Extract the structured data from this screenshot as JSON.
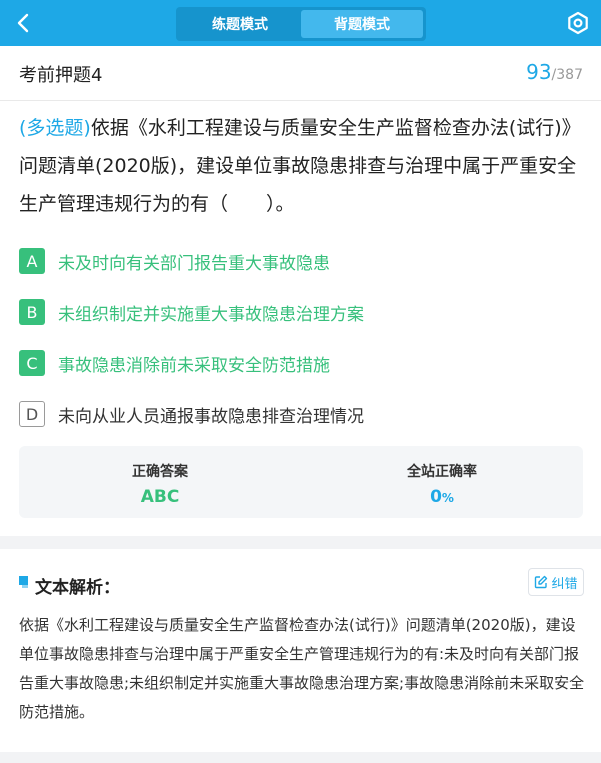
{
  "colors": {
    "primary": "#1ea8e6",
    "correct": "#37c07c"
  },
  "header": {
    "back_icon": "chevron-left-icon",
    "tabs": [
      {
        "label": "练题模式",
        "active": false
      },
      {
        "label": "背题模式",
        "active": true
      }
    ],
    "settings_icon": "settings-icon"
  },
  "question_header": {
    "title": "考前押题4",
    "current": "93",
    "separator": "/",
    "total": "387"
  },
  "question": {
    "type_label": "(多选题)",
    "text": "依据《水利工程建设与质量安全生产监督检查办法(试行)》问题清单(2020版)，建设单位事故隐患排查与治理中属于严重安全生产管理违规行为的有（　　）。"
  },
  "options": [
    {
      "letter": "A",
      "text": "未及时向有关部门报告重大事故隐患",
      "correct": true
    },
    {
      "letter": "B",
      "text": "未组织制定并实施重大事故隐患治理方案",
      "correct": true
    },
    {
      "letter": "C",
      "text": "事故隐患消除前未采取安全防范措施",
      "correct": true
    },
    {
      "letter": "D",
      "text": "未向从业人员通报事故隐患排查治理情况",
      "correct": false
    }
  ],
  "stats": {
    "answer_label": "正确答案",
    "answer_value": "ABC",
    "rate_label": "全站正确率",
    "rate_value": "0",
    "rate_unit": "%"
  },
  "analysis": {
    "title": "文本解析：",
    "report_label": "纠错",
    "report_icon": "edit-icon",
    "text": "依据《水利工程建设与质量安全生产监督检查办法(试行)》问题清单(2020版)，建设单位事故隐患排查与治理中属于严重安全生产管理违规行为的有:未及时向有关部门报告重大事故隐患;未组织制定并实施重大事故隐患治理方案;事故隐患消除前未采取安全防范措施。"
  }
}
